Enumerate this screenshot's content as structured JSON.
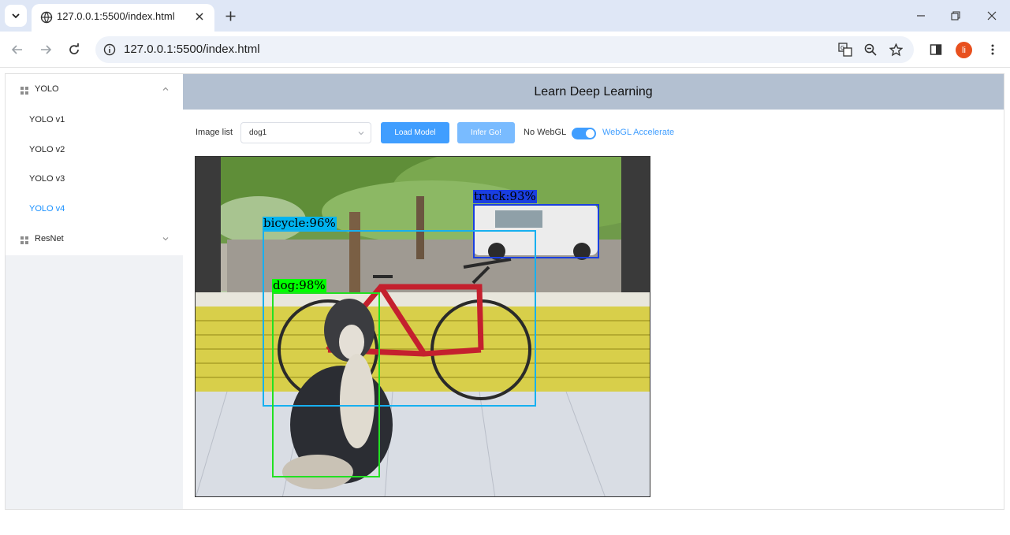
{
  "browser": {
    "tab_title": "127.0.0.1:5500/index.html",
    "url": "127.0.0.1:5500/index.html",
    "profile_initial": "li"
  },
  "sidebar": {
    "groups": [
      {
        "label": "YOLO",
        "expanded": true,
        "items": [
          {
            "label": "YOLO v1",
            "active": false
          },
          {
            "label": "YOLO v2",
            "active": false
          },
          {
            "label": "YOLO v3",
            "active": false
          },
          {
            "label": "YOLO v4",
            "active": true
          }
        ]
      },
      {
        "label": "ResNet",
        "expanded": false,
        "items": []
      }
    ]
  },
  "header": {
    "title": "Learn Deep Learning"
  },
  "controls": {
    "image_list_label": "Image list",
    "image_selected": "dog1",
    "load_button": "Load Model",
    "infer_button": "Infer Go!",
    "no_webgl_label": "No WebGL",
    "webgl_label": "WebGL Accelerate",
    "webgl_enabled": true
  },
  "detections": [
    {
      "label": "truck:93%",
      "color": "#1a3fe0",
      "tag_color": "#1a3fe0"
    },
    {
      "label": "bicycle:96%",
      "color": "#17b0f0",
      "tag_color": "#00b4f0"
    },
    {
      "label": "dog:98%",
      "color": "#22e022",
      "tag_color": "#00ff00"
    }
  ],
  "colors": {
    "accent": "#409eff",
    "header_bg": "#b3c0d1",
    "active_menu": "#1890ff"
  }
}
